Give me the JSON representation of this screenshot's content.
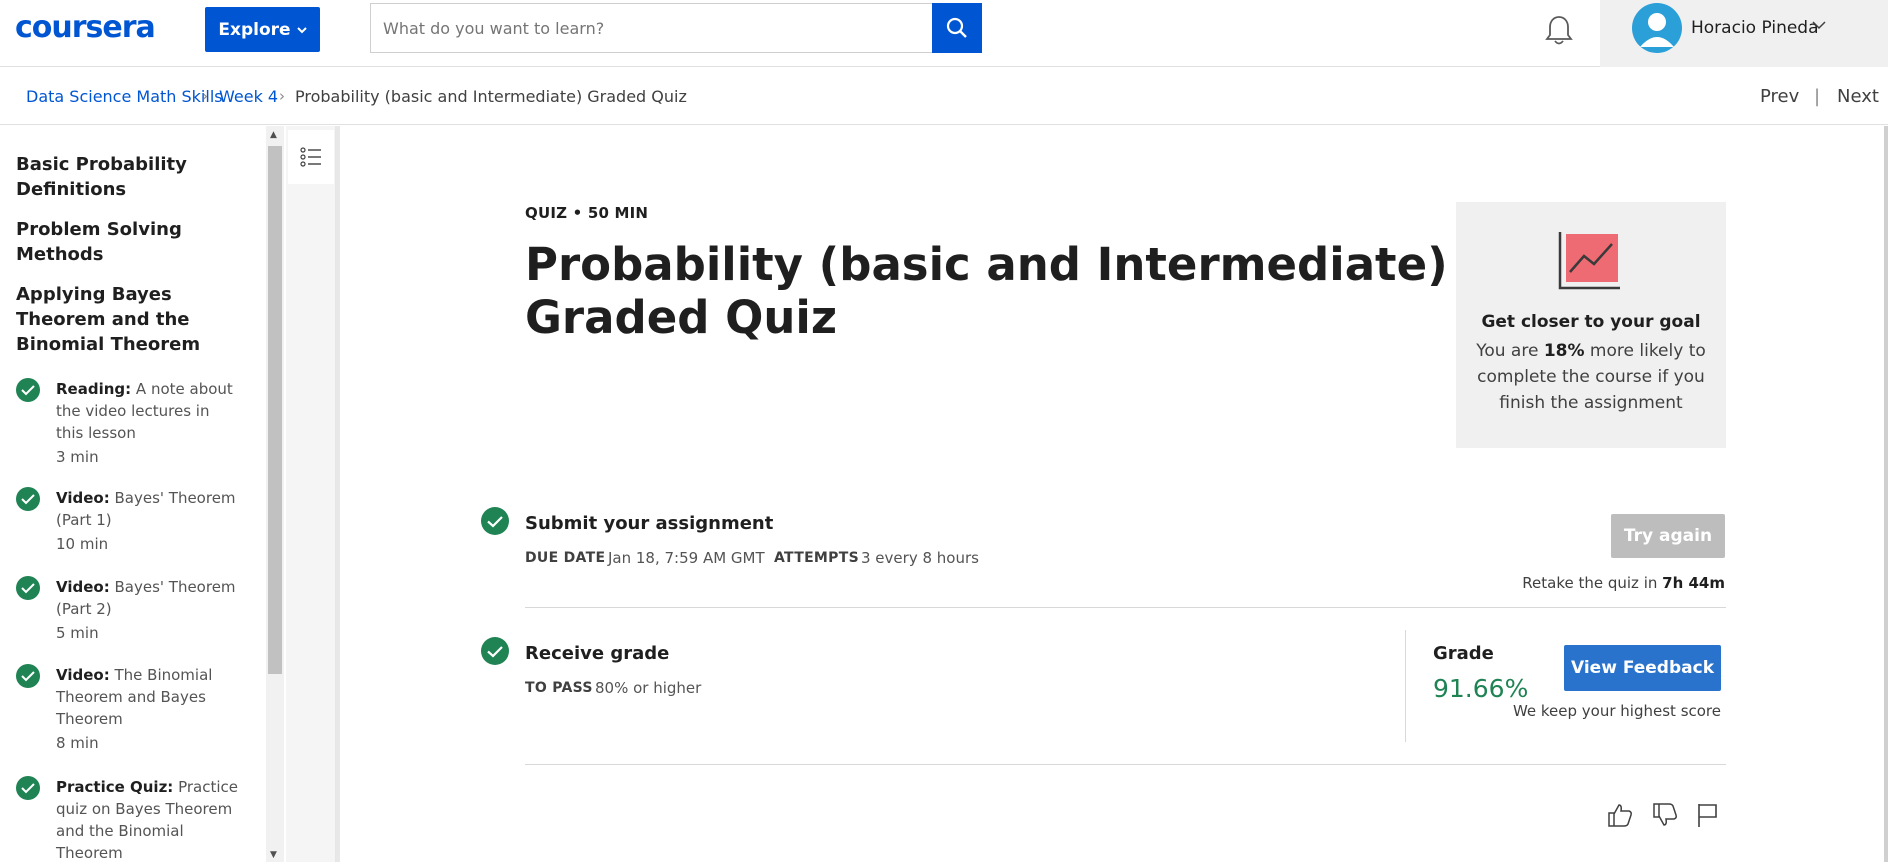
{
  "header": {
    "logo": "coursera",
    "explore_label": "Explore",
    "search_placeholder": "What do you want to learn?",
    "user_name": "Horacio Pineda"
  },
  "breadcrumb": {
    "course": "Data Science Math Skills",
    "week": "Week 4",
    "current": "Probability (basic and Intermediate) Graded Quiz"
  },
  "nav": {
    "prev": "Prev",
    "next": "Next",
    "separator": "|"
  },
  "sidebar": {
    "sections": [
      "Basic Probability Definitions",
      "Problem Solving Methods",
      "Applying Bayes Theorem and the Binomial Theorem"
    ],
    "items": [
      {
        "type": "Reading:",
        "title": "A note about the video lectures in this lesson",
        "duration": "3 min",
        "completed": true
      },
      {
        "type": "Video:",
        "title": "Bayes' Theorem (Part 1)",
        "duration": "10 min",
        "completed": true
      },
      {
        "type": "Video:",
        "title": "Bayes' Theorem (Part 2)",
        "duration": "5 min",
        "completed": true
      },
      {
        "type": "Video:",
        "title": "The Binomial Theorem and Bayes Theorem",
        "duration": "8 min",
        "completed": true
      },
      {
        "type": "Practice Quiz:",
        "title": "Practice quiz on Bayes Theorem and the Binomial Theorem",
        "duration": "",
        "completed": true
      }
    ]
  },
  "quiz": {
    "meta": "QUIZ • 50 MIN",
    "title": "Probability (basic and Intermediate) Graded Quiz"
  },
  "goal_card": {
    "heading": "Get closer to your goal",
    "body_pre": "You are ",
    "body_strong": "18%",
    "body_post": " more likely to complete the course if you finish the assignment"
  },
  "submit": {
    "title": "Submit your assignment",
    "due_key": "DUE DATE",
    "due_value": "Jan 18, 7:59 AM GMT",
    "attempts_key": "ATTEMPTS",
    "attempts_value": "3 every 8 hours",
    "try_again_label": "Try again",
    "retake_pre": "Retake the quiz in ",
    "retake_time": "7h 44m"
  },
  "grade": {
    "title": "Receive grade",
    "pass_key": "TO PASS",
    "pass_value": "80% or higher",
    "grade_label": "Grade",
    "grade_value": "91.66%",
    "view_feedback_label": "View Feedback",
    "keep_note": "We keep your highest score"
  },
  "colors": {
    "brand": "#0056d2",
    "success": "#1f8354",
    "button_blue": "#2a73cc",
    "disabled": "#bdbdbd"
  },
  "icons": [
    "search-icon",
    "bell-icon",
    "avatar-icon",
    "chevron-down-icon",
    "outline-list-icon",
    "check-icon",
    "chart-icon",
    "thumbs-up-icon",
    "thumbs-down-icon",
    "flag-icon"
  ]
}
